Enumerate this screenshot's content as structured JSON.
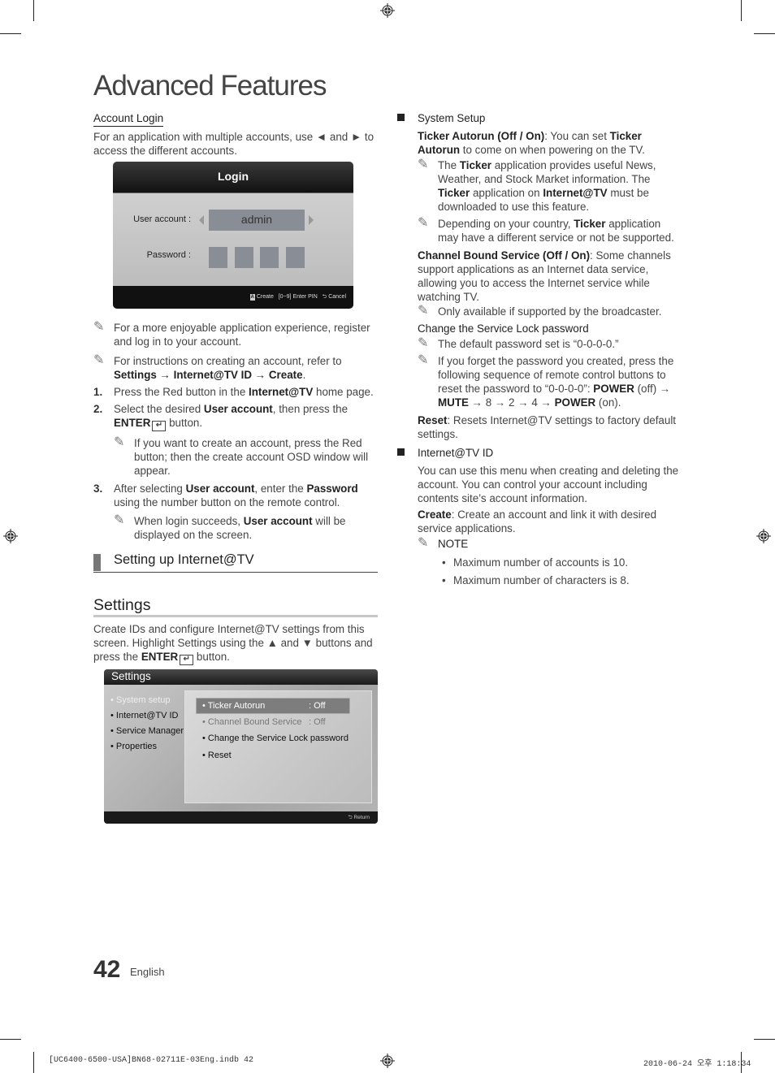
{
  "page": {
    "title": "Advanced Features",
    "page_number": "42",
    "language": "English",
    "slug_left": "[UC6400-6500-USA]BN68-02711E-03Eng.indb   42",
    "slug_right": "2010-06-24   오후 1:18:34"
  },
  "account_login": {
    "heading": "Account Login",
    "intro": "For an application with multiple accounts, use ◄ and ► to access the different accounts.",
    "dialog": {
      "title": "Login",
      "user_account_label": "User account :",
      "user_account_value": "admin",
      "password_label": "Password :",
      "pin_boxes": 4,
      "footer_create_key": "A",
      "footer_create": "Create",
      "footer_enter_pin": "[0~9] Enter PIN",
      "footer_cancel": "Cancel"
    },
    "notes": [
      {
        "text": "For a more enjoyable application experience, register and log in to your account."
      },
      {
        "pre": "For instructions on creating an account, refer to ",
        "bold": "Settings → Internet@TV ID → Create",
        "post": "."
      }
    ],
    "steps": [
      {
        "n": "1.",
        "pre": "Press the Red button in the ",
        "bold": "Internet@TV",
        "post": " home page."
      },
      {
        "n": "2.",
        "pre": "Select the desired ",
        "bold": "User account",
        "mid": ", then press the ",
        "bold2": "ENTER",
        "post": " button.",
        "note": "If you want to create an account, press the Red button; then the create account OSD window will appear."
      },
      {
        "n": "3.",
        "pre": "After selecting ",
        "bold": "User account",
        "mid": ", enter the ",
        "bold2": "Password",
        "post": " using the number button on the remote control.",
        "note_pre": "When login succeeds, ",
        "note_bold": "User account",
        "note_post": " will be displayed on the screen."
      }
    ]
  },
  "section": {
    "title": "Setting up Internet@TV"
  },
  "settings": {
    "heading": "Settings",
    "intro_pre": "Create IDs and configure Internet@TV settings from this screen. Highlight Settings using the  ▲ and ▼ buttons and press the ",
    "intro_bold": "ENTER",
    "intro_post": " button.",
    "dialog": {
      "title": "Settings",
      "left_menu": [
        "• System setup",
        "• Internet@TV ID",
        "• Service Manager",
        "• Properties"
      ],
      "right_items": [
        {
          "label": "• Ticker Autorun",
          "value": ": Off"
        },
        {
          "label": "• Channel Bound Service",
          "value": ": Off"
        },
        {
          "label": "• Change the Service Lock password",
          "value": ""
        },
        {
          "label": "• Reset",
          "value": ""
        }
      ],
      "footer_return": "Return"
    }
  },
  "right_col": {
    "system_setup": {
      "heading": "System Setup",
      "ticker_bold": "Ticker Autorun (Off / On)",
      "ticker_mid": ": You can set ",
      "ticker_bold2": "Ticker Autorun",
      "ticker_post": " to come on when powering on the TV.",
      "ticker_note1_a": "The ",
      "ticker_note1_b": "Ticker",
      "ticker_note1_c": " application provides useful News, Weather, and Stock Market information. The ",
      "ticker_note1_d": "Ticker",
      "ticker_note1_e": " application on ",
      "ticker_note1_f": "Internet@TV",
      "ticker_note1_g": " must be downloaded to use this feature.",
      "ticker_note2_a": "Depending on your country, ",
      "ticker_note2_b": "Ticker",
      "ticker_note2_c": " application may have a different service or not be supported.",
      "cbs_bold": "Channel Bound Service (Off / On)",
      "cbs_text": ": Some channels support applications as an Internet data service, allowing you to access the Internet service while watching TV.",
      "cbs_note": "Only available if supported by the broadcaster.",
      "lock_heading": "Change the Service Lock password",
      "lock_note1": "The default password set is “0-0-0-0.”",
      "lock_note2_a": "If you forget the password you created, press the following sequence of remote control buttons to reset the password to “0-0-0-0”: ",
      "lock_note2_power": "POWER",
      "lock_note2_off": " (off) → ",
      "lock_note2_mute": "MUTE",
      "lock_note2_seq": " → 8 → 2 → 4 → ",
      "lock_note2_power2": "POWER",
      "lock_note2_on": " (on).",
      "reset_bold": "Reset",
      "reset_text": ": Resets Internet@TV settings to factory default settings."
    },
    "tv_id": {
      "heading": "Internet@TV ID",
      "intro": "You can use this menu when creating and deleting the account. You can control your account including contents site’s account information.",
      "create_bold": "Create",
      "create_text": ": Create an account and link it with desired service applications.",
      "note_label": "NOTE",
      "bullets": [
        "Maximum number of accounts is 10.",
        "Maximum number of characters is 8."
      ]
    }
  }
}
